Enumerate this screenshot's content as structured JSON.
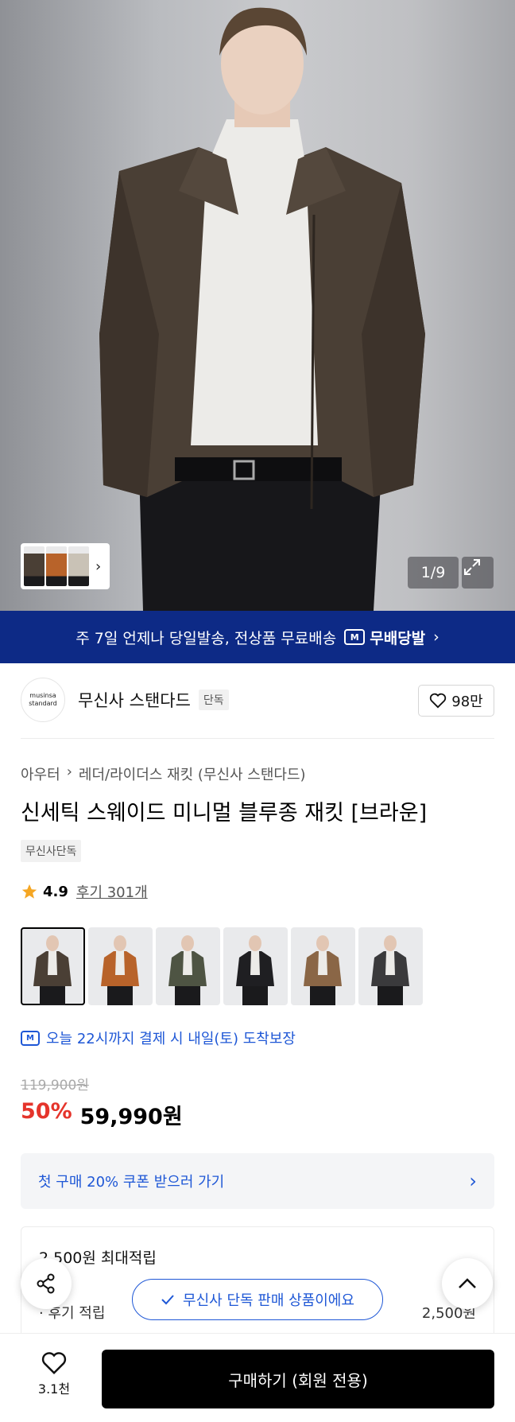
{
  "gallery": {
    "counter": "1/9",
    "thumbnail_colors": [
      "#4a3f35",
      "#b8632a",
      "#c9c2b6"
    ]
  },
  "banner": {
    "text": "주 7일 언제나 당일발송, 전상품 무료배송",
    "badge_icon": "M",
    "badge_label": "무배당발",
    "chevron": "›"
  },
  "brand": {
    "logo_line1": "musinsa",
    "logo_line2": "standard",
    "name": "무신사 스탠다드",
    "tag": "단독",
    "like_count": "98만"
  },
  "breadcrumb": {
    "category": "아우터",
    "separator": "›",
    "subcategory": "레더/라이더스 재킷 (무신사 스탠다드)"
  },
  "product": {
    "title": "신세틱 스웨이드 미니멀 블루종 재킷 [브라운]",
    "exclusive_tag": "무신사단독",
    "rating": "4.9",
    "reviews": "후기 301개",
    "swatch_colors": [
      "#4a3f35",
      "#b8632a",
      "#4e5443",
      "#1f1f22",
      "#8a6646",
      "#3a3a3c"
    ]
  },
  "delivery": {
    "icon": "M",
    "text": "오늘 22시까지 결제 시 내일(토) 도착보장"
  },
  "price": {
    "original": "119,900원",
    "discount": "50%",
    "final": "59,990원"
  },
  "coupon": {
    "text": "첫 구매 20% 쿠폰 받으러 가기",
    "chevron": "›"
  },
  "points": {
    "title": "2,500원 최대적립",
    "row_label": "· 후기 적립",
    "row_value": "2,500원"
  },
  "floating": {
    "exclusive_text": "무신사 단독 판매 상품이에요"
  },
  "bottom_bar": {
    "wish_count": "3.1천",
    "buy_label": "구매하기 (회원 전용)"
  }
}
